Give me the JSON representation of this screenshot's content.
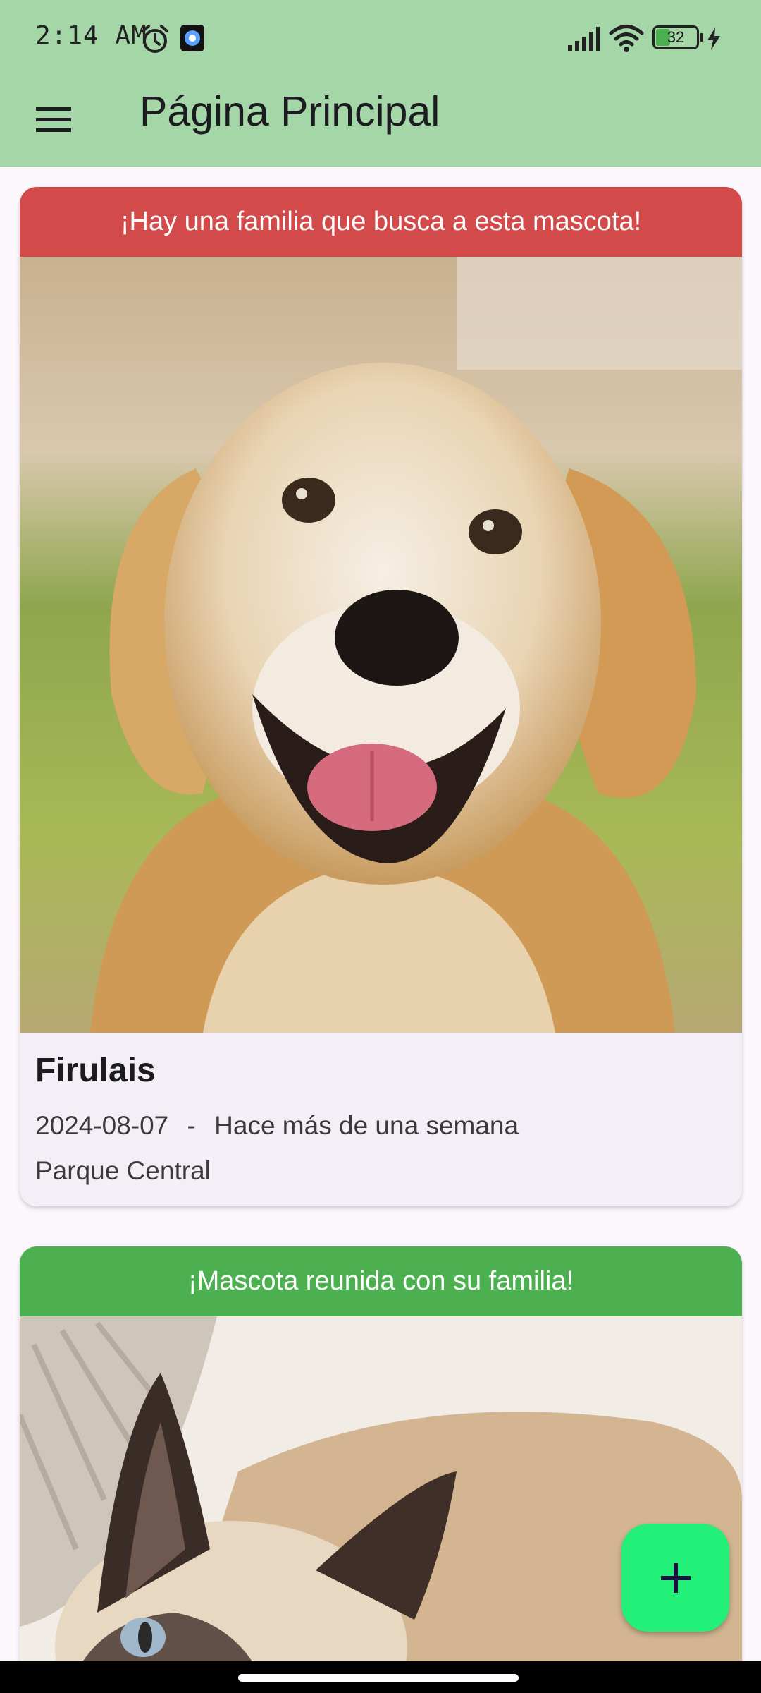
{
  "status_bar": {
    "time": "2:14 AM",
    "battery_level": "32",
    "icons": [
      "alarm-icon",
      "app-notification-icon",
      "signal-icon",
      "wifi-icon",
      "battery-icon",
      "charging-icon"
    ]
  },
  "app_bar": {
    "title": "Página Principal",
    "menu_icon": "menu-icon",
    "background_color": "#a5d6a7"
  },
  "pets": [
    {
      "banner_text": "¡Hay una familia que busca a esta mascota!",
      "banner_color": "#d24a4a",
      "name": "Firulais",
      "date": "2024-08-07",
      "separator": "-",
      "relative_time": "Hace más de una semana",
      "location": "Parque Central"
    },
    {
      "banner_text": "¡Mascota reunida con su familia!",
      "banner_color": "#4caf50"
    }
  ],
  "fab": {
    "icon": "plus-icon",
    "color": "#22f079"
  }
}
